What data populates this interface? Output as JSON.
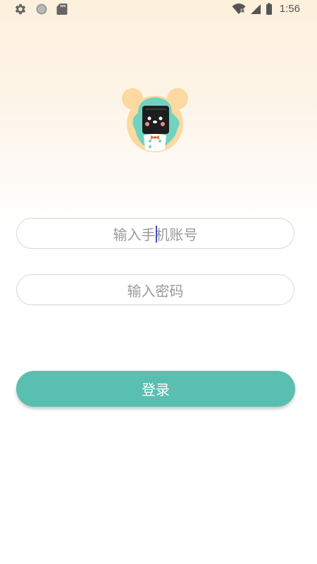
{
  "status_bar": {
    "time": "1:56",
    "left_icons": [
      "gear-icon",
      "circle-icon",
      "sd-card-icon"
    ],
    "right_icons": [
      "wifi-icon",
      "signal-icon",
      "battery-icon"
    ]
  },
  "logo": {
    "icon": "bear-mascot-logo"
  },
  "form": {
    "phone_placeholder": "输入手机账号",
    "password_placeholder": "输入密码"
  },
  "actions": {
    "login_label": "登录"
  },
  "colors": {
    "accent": "#59bfb0",
    "background_top": "#fdf0dc",
    "field_border": "#d6d6d6",
    "placeholder_text": "#9a9a9a",
    "caret": "#3f51b5"
  }
}
